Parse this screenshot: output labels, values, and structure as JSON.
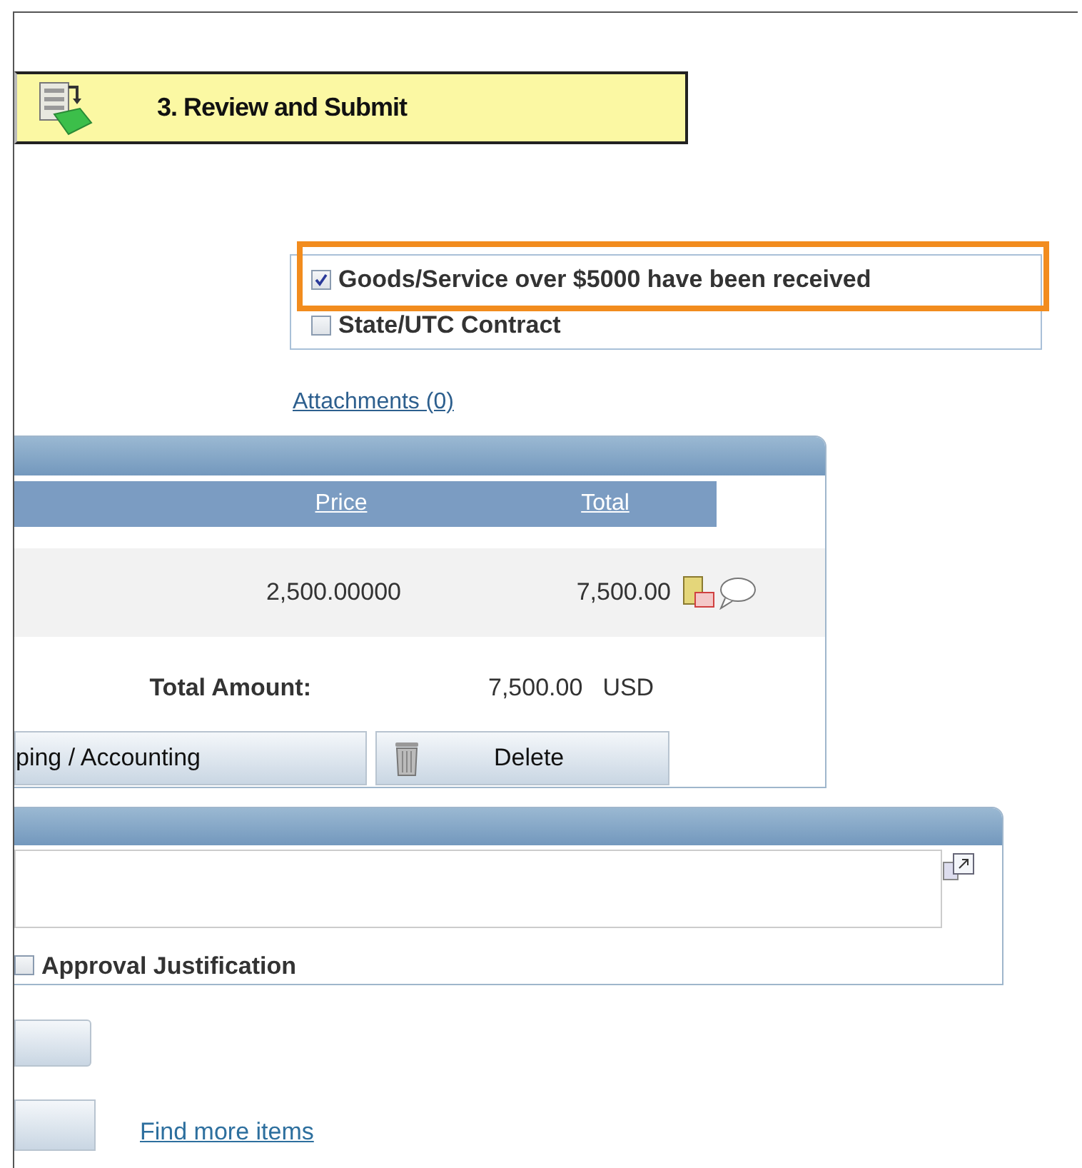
{
  "step": {
    "title": "3. Review and Submit"
  },
  "options": [
    {
      "label": "Goods/Service over $5000 have been received",
      "checked": true
    },
    {
      "label": "State/UTC Contract",
      "checked": false
    }
  ],
  "attachments_link": "Attachments (0)",
  "lines_table": {
    "columns": [
      "Price",
      "Total"
    ],
    "rows": [
      {
        "price": "2,500.00000",
        "total": "7,500.00"
      }
    ],
    "total_label": "Total Amount:",
    "total_value": "7,500.00",
    "currency": "USD",
    "buttons": [
      "ping / Accounting",
      "Delete"
    ]
  },
  "justification": {
    "checkbox_label": "Approval Justification",
    "checked": false
  },
  "find_link": "Find more items"
}
